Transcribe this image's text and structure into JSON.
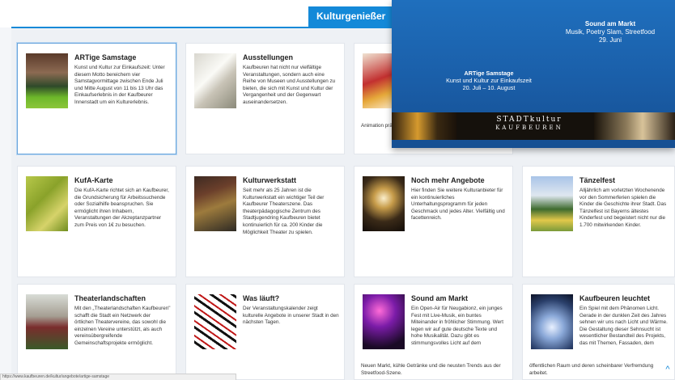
{
  "tab": {
    "label": "Kulturgenießer"
  },
  "cards": [
    {
      "title": "ARTige Samstage",
      "desc": "Kunst und Kultur zur Einkaufszeit: Unter diesem Motto bereichern vier Samstagvormittage zwischen Ende Juli und Mitte August von 11 bis 13 Uhr das Einkaufserlebnis in der Kaufbeurer Innenstadt um ein Kulturerlebnis.",
      "thumb": "artige-samstage-image"
    },
    {
      "title": "Ausstellungen",
      "desc": "Kaufbeuren hat nicht nur vielfältige Veranstaltungen, sondern auch eine Reihe von Museen und Ausstellungen zu bieten, die sich mit Kunst und Kultur der Vergangenheit und der Gegenwart auseinandersetzen.",
      "thumb": "ausstellungen-image"
    },
    {
      "title": "",
      "desc": "Animation präsentier",
      "thumb": "animation-image"
    },
    {
      "title": "KufA-Karte",
      "desc": "Die KufA-Karte richtet sich an Kaufbeurer, die Grundsicherung für Arbeitssuchende oder Sozialhilfe beanspruchen. Sie ermöglicht ihren Inhabern, Veranstaltungen der Akzeptanzpartner zum Preis von 1€ zu besuchen.",
      "thumb": "kufa-karte-image"
    },
    {
      "title": "Kulturwerkstatt",
      "desc": "Seit mehr als 25 Jahren ist die Kulturwerkstatt ein wichtiger Teil der Kaufbeurer Theaterszene. Das theaterpädagogische Zentrum des Stadtjugendring Kaufbeuren bietet kontinuierlich für ca. 200 Kinder die Möglichkeit Theater zu spielen.",
      "thumb": "kulturwerkstatt-image"
    },
    {
      "title": "Noch mehr Angebote",
      "desc": "Hier finden Sie weitere Kulturanbieter für ein kontinuierliches Unterhaltungsprogramm für jeden Geschmack und jedes Alter. Vielfältig und facettenreich.",
      "thumb": "noch-mehr-angebote-image"
    },
    {
      "title": "Tänzelfest",
      "desc": "Alljährlich am vorletzten Wochenende vor den Sommerferien spielen die Kinder die Geschichte ihrer Stadt. Das Tänzelfest ist Bayerns ältestes Kinderfest und begeistert nicht nur die 1.700 mitwirkenden Kinder.",
      "thumb": "taenzelfest-image"
    },
    {
      "title": "Theaterlandschaften",
      "desc": "Mit den „Theaterlandschaften Kaufbeuren\" schafft die Stadt ein Netzwerk der örtlichen Theatervereine, das sowohl die einzelnen Vereine unterstützt, als auch vereinsübergreifende Gemeinschaftsprojekte ermöglicht.",
      "thumb": "theaterlandschaften-image"
    },
    {
      "title": "Was läuft?",
      "desc": "Der Veranstaltungskalender zeigt kulturelle Angebote in unserer Stadt in den nächsten Tagen.",
      "thumb": "was-laeuft-image"
    },
    {
      "title": "Sound am Markt",
      "desc": "Ein Open-Air für Neugabionz, ein junges Fest mit Live-Musik, ein buntes Miteinander in fröhlicher Stimmung. Wert legen wir auf gute deutsche Texte und hohe Musikalität. Dazu gibt es stimmungsvolles Licht auf dem",
      "desc_wide": "Neuen Markt, kühle Getränke und die neusten Trends aus der Streetfood-Szene.",
      "thumb": "sound-am-markt-image"
    },
    {
      "title": "Kaufbeuren leuchtet",
      "desc": "Ein Spiel mit dem Phänomen Licht. Gerade in der dunklen Zeit des Jahres sehnen wir uns nach Licht und Wärme. Die Gestaltung dieser Sehnsucht ist wesentlicher Bestandteil des Projekts, das mit Themen, Fassaden, dem",
      "desc_wide": "öffentlichen Raum und deren scheinbarer Verfremdung arbeitet.",
      "thumb": "kaufbeuren-leuchtet-image"
    }
  ],
  "banner": {
    "sound_title": "Sound am Markt",
    "sound_sub": "Musik, Poetry Slam, Streetfood",
    "sound_date": "29. Juni",
    "art_title": "ARTige Samstage",
    "art_sub": "Kunst und Kultur zur Einkaufszeit",
    "art_date": "20. Juli – 10. August",
    "logo_line1": "STADTkultur",
    "logo_line2": "KAUFBEUREN"
  },
  "statusbar": {
    "text": "https://www.kaufbeuren.de/kultur/angebote/artige-samstage"
  },
  "scroll_up": {
    "glyph": "^"
  }
}
